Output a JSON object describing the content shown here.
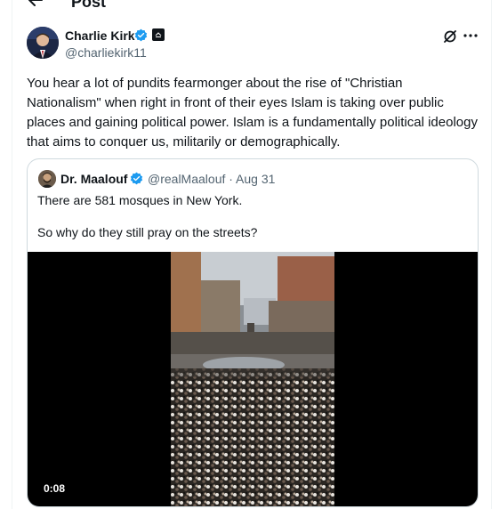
{
  "header": {
    "back_icon": "arrow-left-icon",
    "title": "Post"
  },
  "post": {
    "author_name": "Charlie Kirk",
    "author_handle": "@charliekirk11",
    "verified_color": "#1d9bf0",
    "text": "You hear a lot of pundits fearmonger about the rise of \"Christian Nationalism\" when right in front of their eyes Islam is taking over public places and gaining political power. Islam is a fundamentally political ideology that aims to conquer us, militarily or demographically."
  },
  "quote": {
    "author_name": "Dr. Maalouf",
    "author_handle": "@realMaalouf",
    "date": "Aug 31",
    "line1": "There are 581 mosques in New York.",
    "line2": "So why do they still pray on the streets?",
    "video_time": "0:08"
  }
}
